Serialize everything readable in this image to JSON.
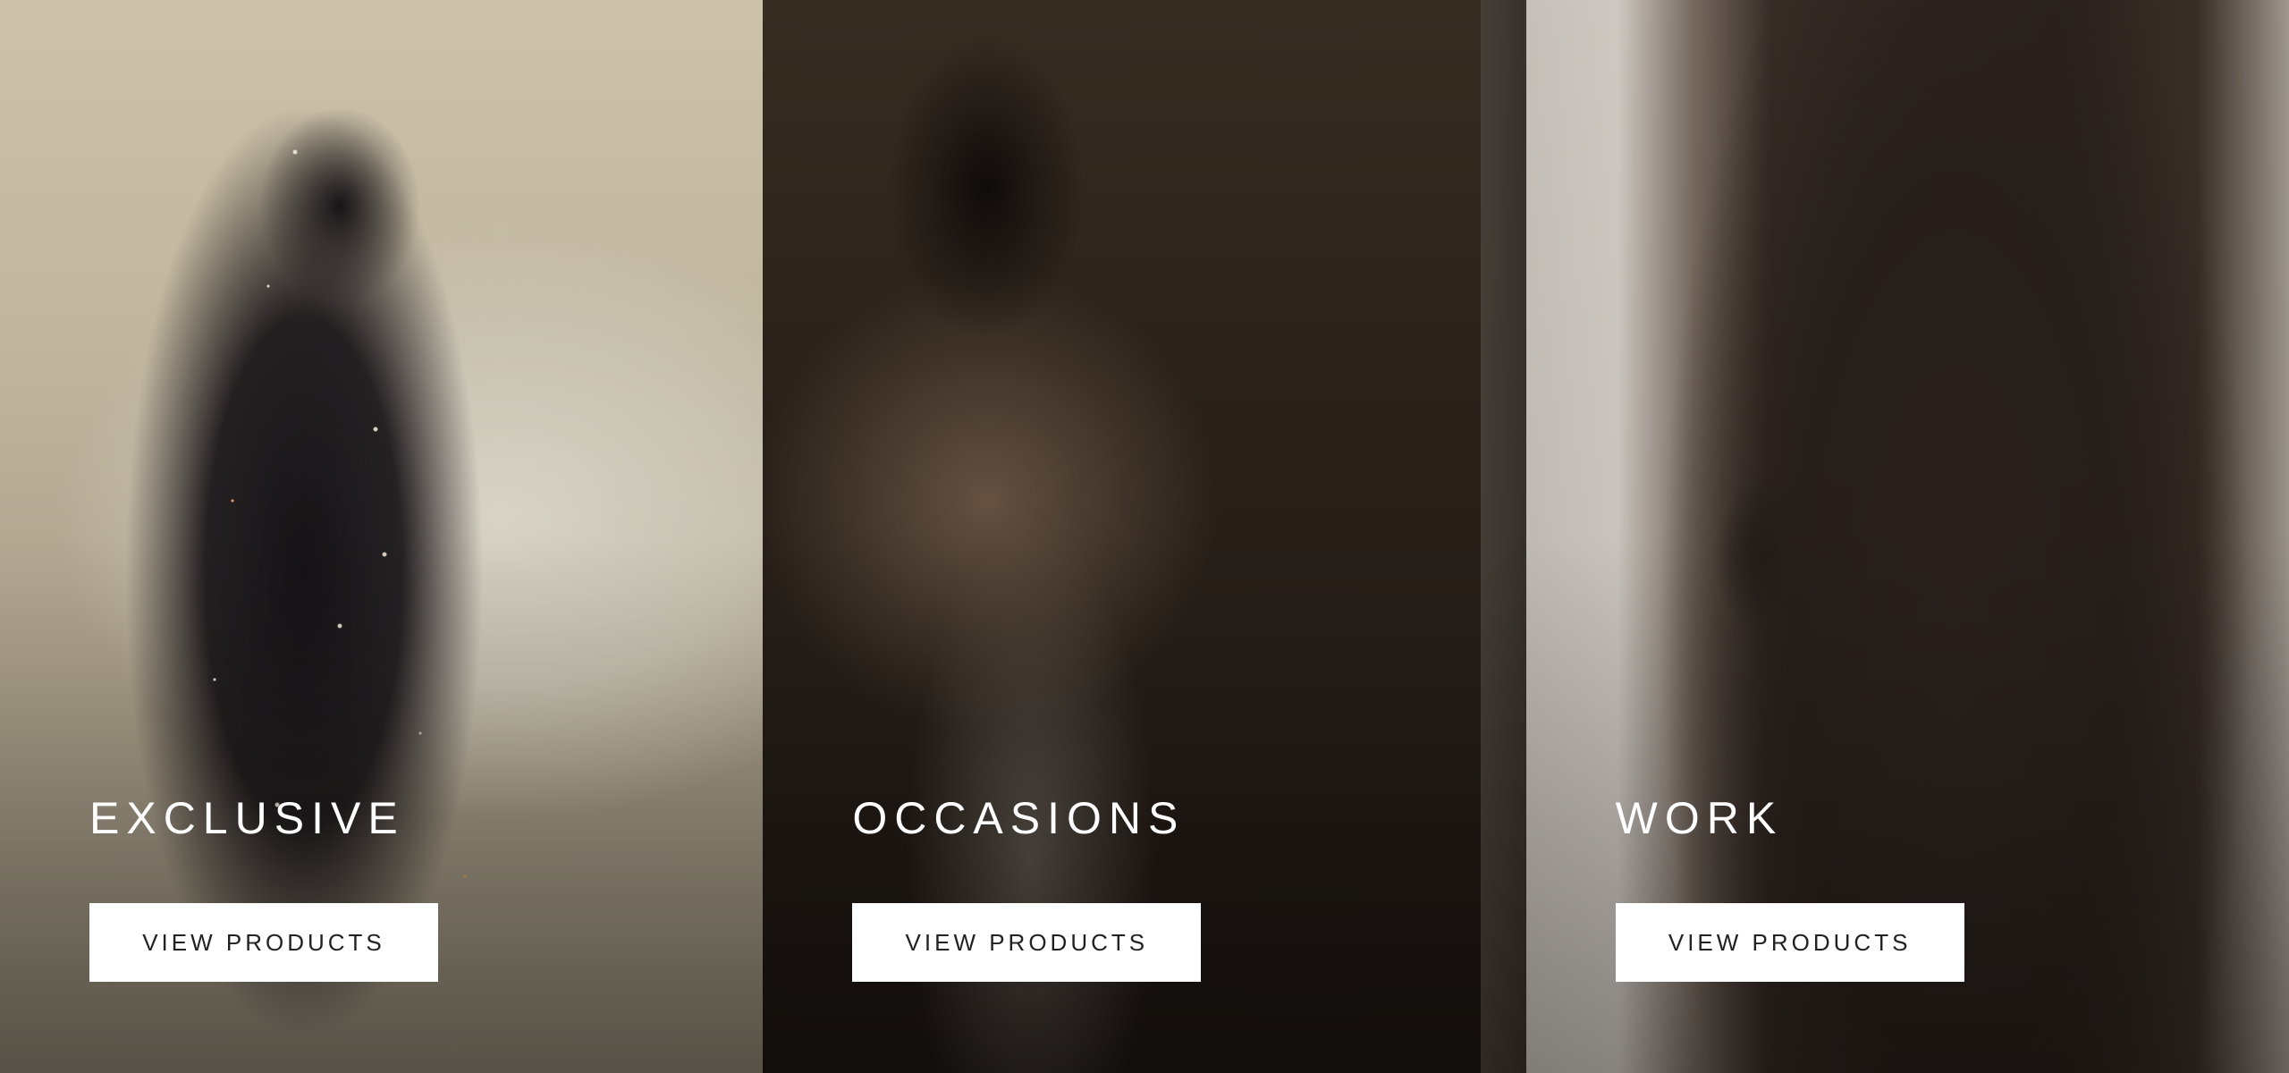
{
  "collections": [
    {
      "title": "EXCLUSIVE",
      "button_label": "VIEW PRODUCTS"
    },
    {
      "title": "OCCASIONS",
      "button_label": "VIEW PRODUCTS"
    },
    {
      "title": "WORK",
      "button_label": "VIEW PRODUCTS"
    }
  ]
}
